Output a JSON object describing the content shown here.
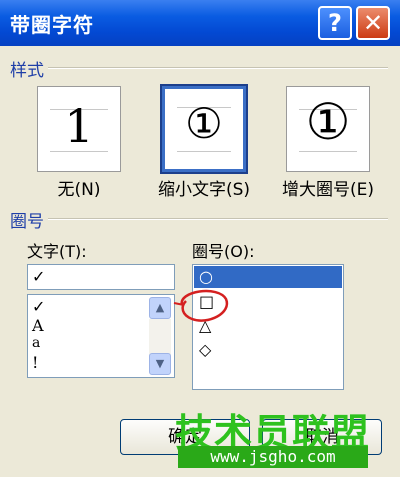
{
  "window": {
    "title": "带圈字符",
    "help_glyph": "?",
    "close_glyph": "✕"
  },
  "style_section": {
    "label": "样式",
    "options": [
      {
        "glyph": "1",
        "caption": "无(N)"
      },
      {
        "glyph": "①",
        "caption": "缩小文字(S)"
      },
      {
        "glyph": "①",
        "caption": "增大圈号(E)"
      }
    ],
    "selected_index": 1
  },
  "enclosure_section": {
    "label": "圈号",
    "text_label": "文字(T):",
    "text_value": "✓",
    "text_list": [
      "✓",
      "A",
      "a",
      "!"
    ],
    "symbol_label": "圈号(O):",
    "symbols": [
      "○",
      "□",
      "△",
      "◇"
    ],
    "selected_symbol_index": 0
  },
  "buttons": {
    "ok": "确定",
    "cancel": "取消"
  },
  "watermark": {
    "text": "技术员联盟",
    "url": "www.jsgho.com"
  },
  "colors": {
    "titlebar": "#0a5ce2",
    "accent": "#316ac5",
    "watermark": "#2ec21e"
  }
}
